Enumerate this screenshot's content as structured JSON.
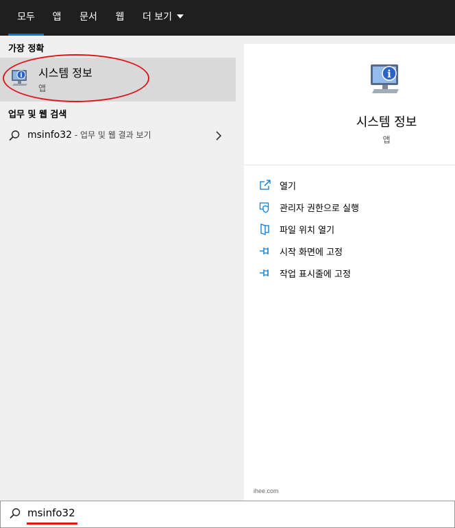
{
  "tabs": [
    {
      "label": "모두",
      "active": true
    },
    {
      "label": "앱"
    },
    {
      "label": "문서"
    },
    {
      "label": "웹"
    },
    {
      "label": "더 보기"
    }
  ],
  "left": {
    "best_match_heading": "가장 정확",
    "best_match": {
      "title": "시스템 정보",
      "subtitle": "앱",
      "icon": "system-info-icon"
    },
    "web_heading": "업무 및 웹 검색",
    "web_result": {
      "query": "msinfo32",
      "hint": " - 업무 및 웹 결과 보기",
      "icon": "search-icon"
    }
  },
  "detail": {
    "title": "시스템 정보",
    "subtitle": "앱",
    "actions": [
      {
        "label": "열기",
        "icon": "open-icon"
      },
      {
        "label": "관리자 권한으로 실행",
        "icon": "shield-icon"
      },
      {
        "label": "파일 위치 열기",
        "icon": "file-location-icon"
      },
      {
        "label": "시작 화면에 고정",
        "icon": "pin-icon"
      },
      {
        "label": "작업 표시줄에 고정",
        "icon": "pin-icon"
      }
    ],
    "watermark": "ihee.com"
  },
  "search": {
    "value": "msinfo32",
    "icon": "search-icon"
  },
  "colors": {
    "accent": "#0078d7",
    "annotation": "#e0161b",
    "topbar": "#1f1f1f"
  }
}
